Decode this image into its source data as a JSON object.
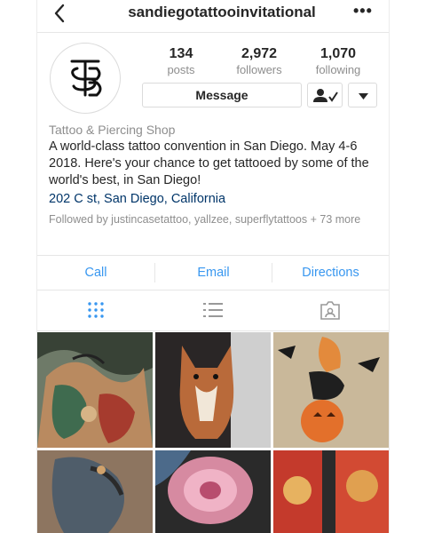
{
  "header": {
    "username": "sandiegotattooinvitational",
    "more_label": "•••"
  },
  "stats": [
    {
      "value": "134",
      "label": "posts"
    },
    {
      "value": "2,972",
      "label": "followers"
    },
    {
      "value": "1,070",
      "label": "following"
    }
  ],
  "actions": {
    "message_label": "Message"
  },
  "bio": {
    "category": "Tattoo & Piercing Shop",
    "text": "A world-class tattoo convention in San Diego. May 4-6 2018. Here's your chance to get tattooed by some of the world's best, in San Diego!",
    "address": "202 C st, San Diego, California",
    "followed_by": "Followed by justincasetattoo, yallzee, superflytattoos + 73 more"
  },
  "contact": {
    "call": "Call",
    "email": "Email",
    "directions": "Directions"
  },
  "colors": {
    "link_blue": "#3897f0",
    "address_blue": "#003569",
    "secondary_text": "#8e8e8e",
    "divider": "#e6e6e6"
  },
  "icons": [
    "back-icon",
    "more-icon",
    "profile-logo",
    "follow-check-icon",
    "dropdown-icon",
    "grid-view-icon",
    "list-view-icon",
    "tagged-icon"
  ]
}
